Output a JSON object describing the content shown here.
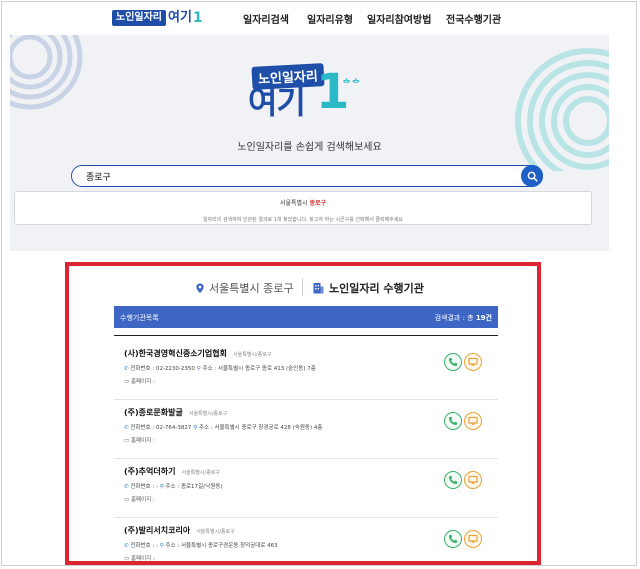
{
  "header": {
    "logo_badge": "노인일자리",
    "logo_word": "여기",
    "logo_mark": "1",
    "menu": [
      "일자리검색",
      "일자리유형",
      "일자리참여방법",
      "전국수행기관"
    ]
  },
  "hero": {
    "logo_badge": "노인일자리",
    "logo_word": "여기",
    "logo_mark": "1",
    "logo_mark_small": "ᅌᅌ",
    "tagline": "노인일자리를 손쉽게 검색해보세요",
    "search_value": "종로구",
    "result_region": "서울특별시",
    "result_district": "종로구",
    "result_note": "일자리의 검색하여 인관된 결과로 1개 찾았습니다. 찾고자 하는 시군구를 선택해서 클릭해주세요"
  },
  "section": {
    "location": "서울특별시 종로구",
    "title": "노인일자리 수행기관",
    "list_label": "수행기관목록",
    "count_label": "검색결과 : 총 ",
    "count_value": "19건"
  },
  "orgs": [
    {
      "name": "(사)한국경영혁신중소기업협회",
      "region": "서울특별시/종로구",
      "phone_label": "전화번호 : 02-2230-2350",
      "addr_label": "주소 : 서울특별시 종로구 종로 413 (숭인동) 7층",
      "home_label": "홈페이지 :"
    },
    {
      "name": "(주)종로문화발굴",
      "region": "서울특별시/종로구",
      "phone_label": "전화번호 : 02-764-3827",
      "addr_label": "주소 : 서울특별시 종로구 창경궁로 428 (숙원동) 4층",
      "home_label": "홈페이지 :"
    },
    {
      "name": "(주)추억더하기",
      "region": "서울특별시/종로구",
      "phone_label": "전화번호 : -",
      "addr_label": "주소 : 종로17길(낙원동)",
      "home_label": "홈페이지 :"
    },
    {
      "name": "(주)발리서치코리아",
      "region": "서울특별시/종로구",
      "phone_label": "전화번호 : -",
      "addr_label": "주소 : 서울특별시 종로구경운동 창덕궁대로 463",
      "home_label": "홈페이지 :"
    }
  ],
  "colors": {
    "brand": "#1e4ea8",
    "accent": "#2bb9c8",
    "frame": "#dc2530",
    "list_bar": "#3d66c4"
  },
  "icons": [
    "search-icon",
    "location-pin-icon",
    "building-icon",
    "phone-icon",
    "pin-icon",
    "home-icon",
    "call-button-icon",
    "homepage-button-icon"
  ]
}
